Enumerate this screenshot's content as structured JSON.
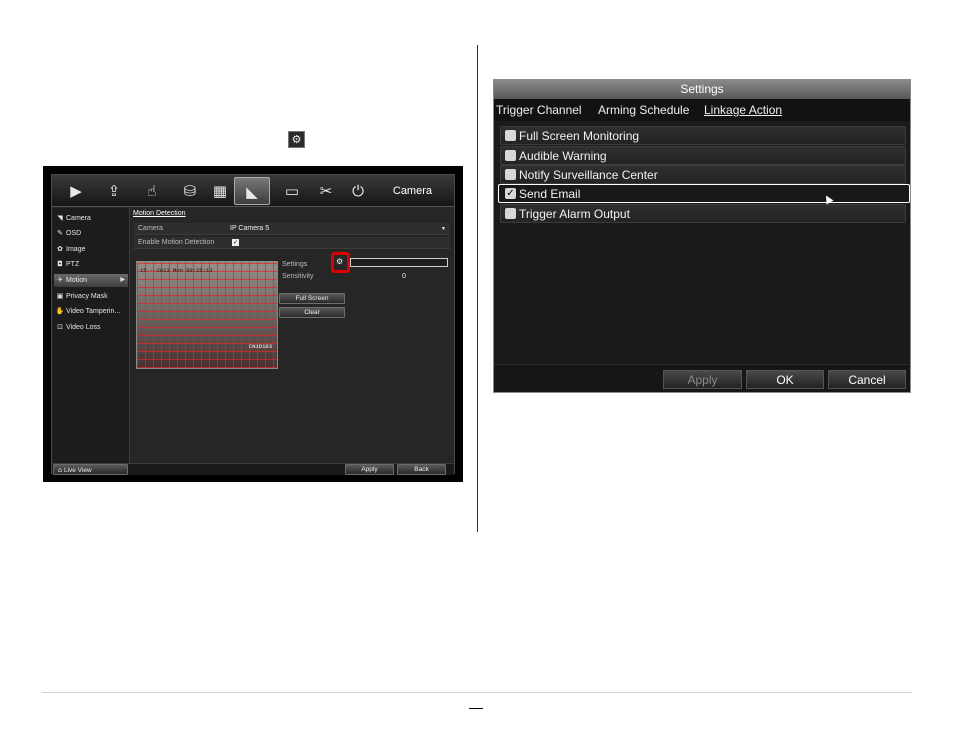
{
  "inline_icon": "gear-icon",
  "dvr": {
    "toolbar": {
      "icons": [
        "play-icon",
        "export-icon",
        "manual-icon",
        "hdd-icon",
        "record-icon",
        "camera-icon",
        "configuration-icon",
        "maintenance-icon",
        "shutdown-icon"
      ],
      "active_index": 5,
      "title": "Camera"
    },
    "sidebar": {
      "items": [
        {
          "label": "Camera",
          "icon": "camera-icon"
        },
        {
          "label": "OSD",
          "icon": "osd-icon"
        },
        {
          "label": "Image",
          "icon": "image-icon"
        },
        {
          "label": "PTZ",
          "icon": "ptz-icon"
        },
        {
          "label": "Motion",
          "icon": "motion-icon"
        },
        {
          "label": "Privacy Mask",
          "icon": "privacy-mask-icon"
        },
        {
          "label": "Video Tamperin...",
          "icon": "video-tampering-icon"
        },
        {
          "label": "Video Loss",
          "icon": "video-loss-icon"
        }
      ],
      "selected_index": 4,
      "live_view": "Live View"
    },
    "panel": {
      "tab": "Motion Detection",
      "camera_label": "Camera",
      "camera_value": "IP Camera 5",
      "enable_label": "Enable Motion Detection",
      "enable_checked": true,
      "settings_label": "Settings",
      "sensitivity_label": "Sensitivity",
      "sensitivity_value": "0",
      "full_screen": "Full Screen",
      "clear": "Clear",
      "video_timestamp": "15-·-2013 Mon 09:25:13",
      "video_camera": "CN1D103"
    },
    "buttons": {
      "apply": "Apply",
      "back": "Back"
    }
  },
  "settings_dialog": {
    "title": "Settings",
    "tabs": [
      "Trigger Channel",
      "Arming Schedule",
      "Linkage Action"
    ],
    "active_tab": 2,
    "items": [
      {
        "label": "Full Screen Monitoring",
        "checked": false
      },
      {
        "label": "Audible Warning",
        "checked": false
      },
      {
        "label": "Notify Surveillance Center",
        "checked": false
      },
      {
        "label": "Send Email",
        "checked": true
      },
      {
        "label": "Trigger Alarm Output",
        "checked": false
      }
    ],
    "selected_index": 3,
    "buttons": {
      "apply": "Apply",
      "ok": "OK",
      "cancel": "Cancel"
    }
  }
}
